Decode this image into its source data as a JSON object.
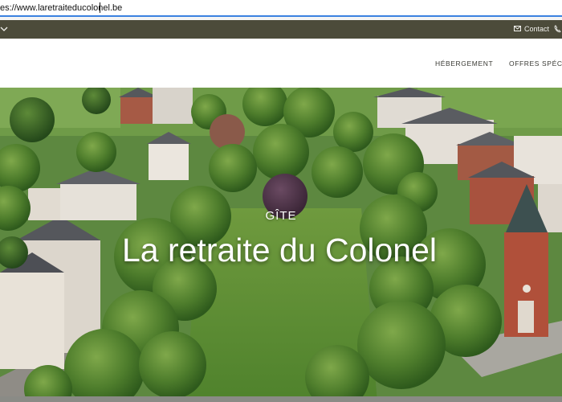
{
  "browser": {
    "url": "es://www.laretraiteducolonel.be"
  },
  "topbar": {
    "contact_label": "Contact",
    "icons": [
      "chevron-down-icon",
      "mail-icon",
      "phone-icon"
    ],
    "background": "#4c4b3a"
  },
  "nav": {
    "items": [
      {
        "label": "HÉBERGEMENT"
      },
      {
        "label": "OFFRES SPÉCIA"
      }
    ]
  },
  "hero": {
    "kicker": "GÎTE",
    "title": "La retraite du Colonel",
    "text_color": "#ffffff"
  },
  "colors": {
    "accent_focus": "#3b82e0",
    "grass": "#5f8a3c",
    "tree_dark": "#2f5a1e",
    "roof_gray": "#5a5c61",
    "brick": "#9a4a3a"
  }
}
